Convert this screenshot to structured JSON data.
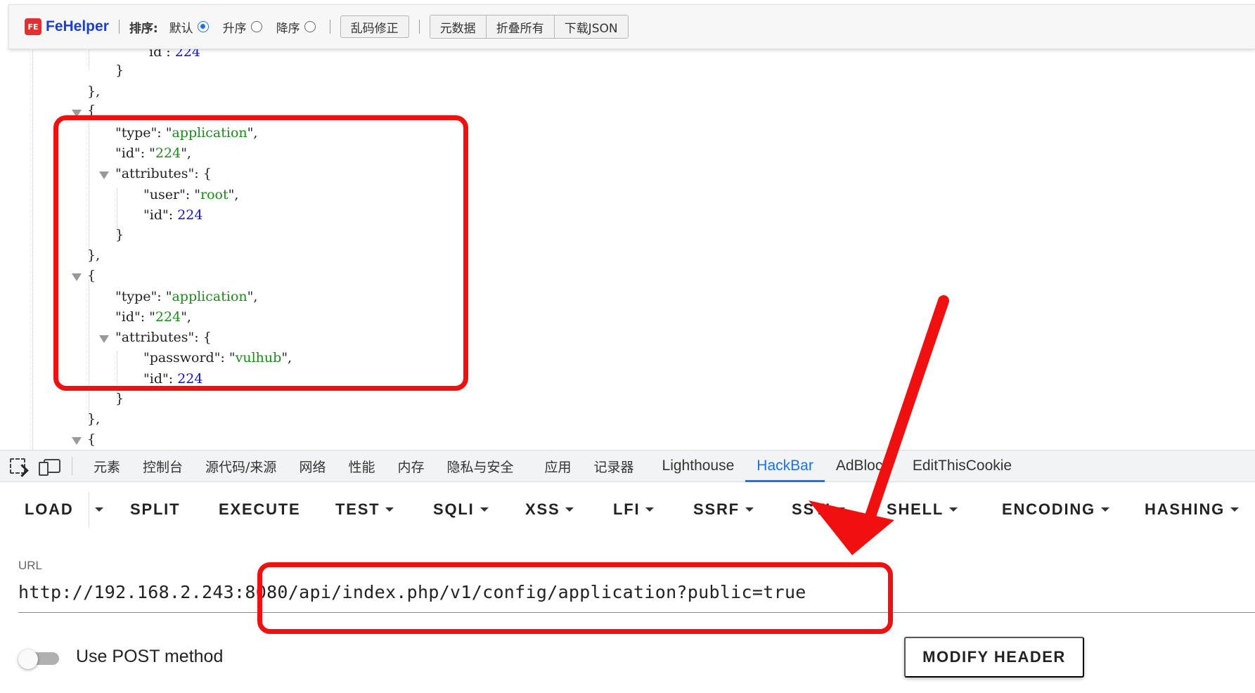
{
  "fehelper": {
    "logo_mark": "FE",
    "logo_text": "FeHelper",
    "sort_label": "排序:",
    "sort_options": [
      {
        "label": "默认",
        "selected": true
      },
      {
        "label": "升序",
        "selected": false
      },
      {
        "label": "降序",
        "selected": false
      }
    ],
    "fix_encoding_button": "乱码修正",
    "metadata_button": "元数据",
    "collapse_all_button": "折叠所有",
    "download_json_button": "下载JSON"
  },
  "json_view": {
    "top_partial": {
      "key": "id",
      "value": "224"
    },
    "record1": {
      "type_key": "type",
      "type_value": "application",
      "id_key": "id",
      "id_value": "224",
      "attributes_key": "attributes",
      "attr_key": "user",
      "attr_value": "root",
      "attr_id_key": "id",
      "attr_id_value": "224"
    },
    "record2": {
      "type_key": "type",
      "type_value": "application",
      "id_key": "id",
      "id_value": "224",
      "attributes_key": "attributes",
      "attr_key": "password",
      "attr_value": "vulhub",
      "attr_id_key": "id",
      "attr_id_value": "224"
    }
  },
  "devtools": {
    "tabs": [
      "元素",
      "控制台",
      "源代码/来源",
      "网络",
      "性能",
      "内存",
      "隐私与安全",
      "应用",
      "记录器",
      "Lighthouse",
      "HackBar",
      "AdBlock",
      "EditThisCookie"
    ],
    "active_tab": "HackBar"
  },
  "hackbar": {
    "menu": [
      "LOAD",
      "SPLIT",
      "EXECUTE",
      "TEST",
      "SQLI",
      "XSS",
      "LFI",
      "SSRF",
      "SSTI",
      "SHELL",
      "ENCODING",
      "HASHING"
    ],
    "url_label": "URL",
    "url_value": "http://192.168.2.243:8080/api/index.php/v1/config/application?public=true",
    "post_label": "Use POST method",
    "post_enabled": false,
    "modify_header_button": "MODIFY HEADER"
  },
  "colors": {
    "annotation_red": "#f01010",
    "active_tab_blue": "#1a73e8",
    "json_string_green": "#1a8a1a",
    "json_number_blue": "#1313c8"
  }
}
